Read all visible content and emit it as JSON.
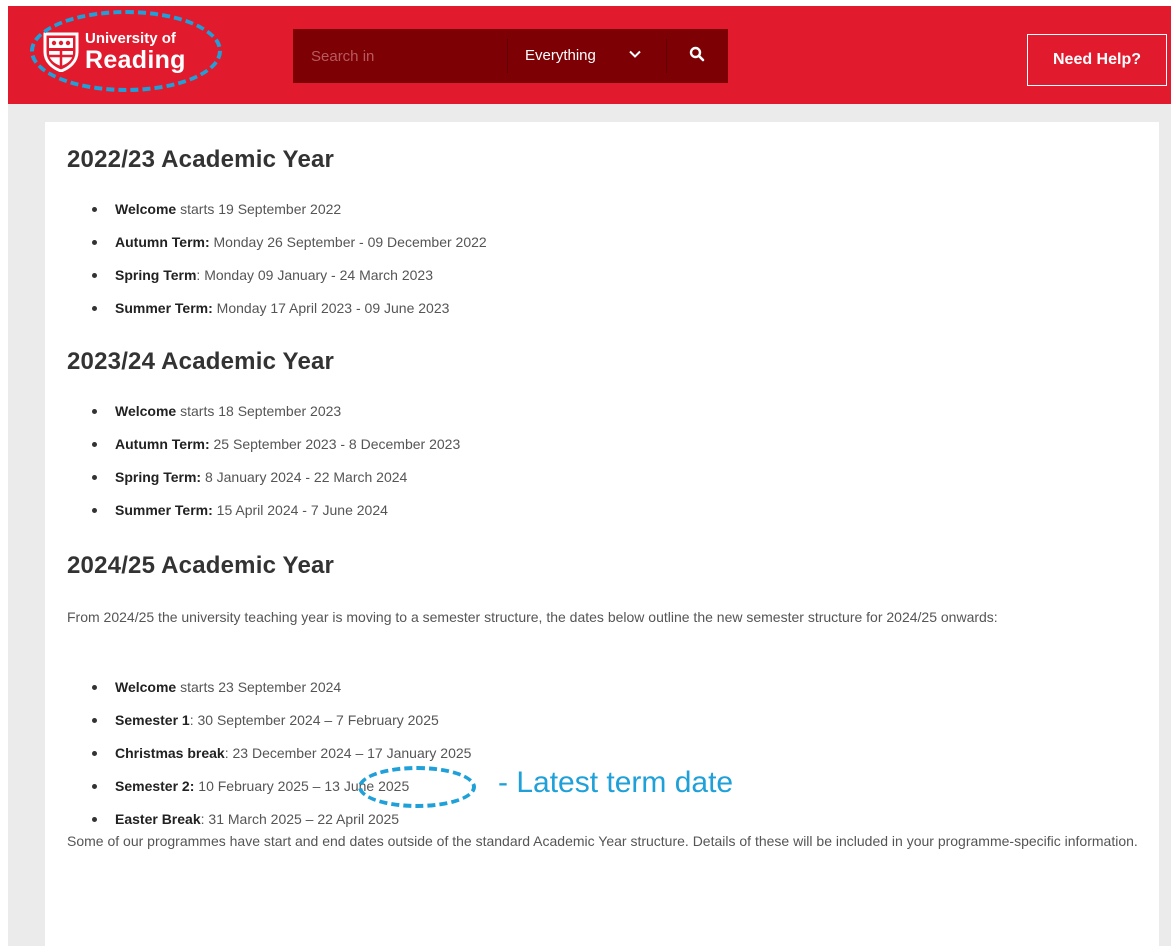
{
  "header": {
    "logo_line1": "University of",
    "logo_line2": "Reading",
    "search_placeholder": "Search in",
    "scope_label": "Everything",
    "help_label": "Need Help?",
    "brand_color": "#e11b2d",
    "search_bg": "#7c0004"
  },
  "sections": [
    {
      "heading": "2022/23 Academic Year",
      "items": [
        {
          "label": "Welcome",
          "text": " starts 19 September 2022"
        },
        {
          "label": "Autumn Term:",
          "text": " Monday 26 September - 09 December 2022"
        },
        {
          "label": "Spring Term",
          "text": ": Monday 09 January - 24 March 2023"
        },
        {
          "label": "Summer Term:",
          "text": " Monday 17 April 2023 - 09 June 2023"
        }
      ]
    },
    {
      "heading": "2023/24 Academic Year",
      "items": [
        {
          "label": "Welcome",
          "text": " starts 18 September 2023"
        },
        {
          "label": "Autumn Term:",
          "text": " 25 September 2023 - 8 December 2023"
        },
        {
          "label": "Spring Term:",
          "text": " 8 January 2024 - 22 March 2024"
        },
        {
          "label": "Summer Term:",
          "text": " 15 April 2024 -  7 June 2024"
        }
      ]
    },
    {
      "heading": "2024/25 Academic Year",
      "intro": "From 2024/25 the university teaching year is moving to a semester structure, the dates below outline the new semester structure for 2024/25 onwards:",
      "items": [
        {
          "label": "Welcome",
          "text": " starts 23 September 2024"
        },
        {
          "label": "Semester 1",
          "text": ": 30 September 2024 – 7 February 2025"
        },
        {
          "label": "Christmas break",
          "text": ": 23 December 2024 – 17 January 2025"
        },
        {
          "label": "Semester 2:",
          "text": " 10 February 2025 – ",
          "highlight": "13 June 2025"
        },
        {
          "label": "Easter Break",
          "text": ": 31 March 2025 – 22 April 2025"
        }
      ],
      "footer": "Some of our programmes have start and end dates outside of the standard Academic Year structure. Details of these will be included in your programme-specific information."
    }
  ],
  "annotation": {
    "note": "- Latest term date",
    "color": "#1fa0d8"
  }
}
